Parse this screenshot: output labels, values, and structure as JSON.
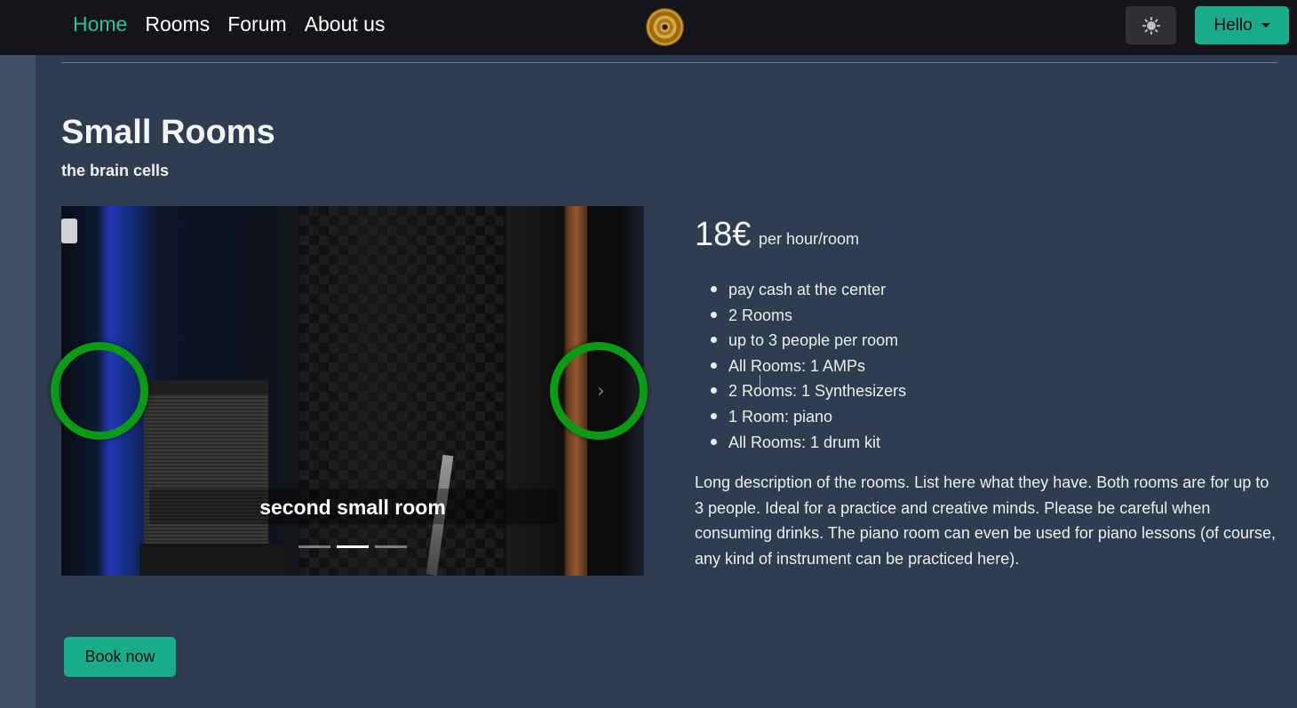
{
  "nav": {
    "links": [
      {
        "label": "Home",
        "active": true
      },
      {
        "label": "Rooms",
        "active": false
      },
      {
        "label": "Forum",
        "active": false
      },
      {
        "label": "About us",
        "active": false
      }
    ],
    "logo_icon": "vinyl-record-icon",
    "theme_icon": "sun-icon",
    "user_button_label": "Hello"
  },
  "room": {
    "title": "Small Rooms",
    "subtitle": "the brain cells",
    "carousel": {
      "caption": "second small room",
      "slide_count": 3,
      "active_index": 1
    },
    "price": "18€",
    "price_unit": "per hour/room",
    "features": [
      "pay cash at the center",
      "2 Rooms",
      "up to 3 people per room",
      "All Rooms: 1 AMPs",
      "2 Rooms: 1 Synthesizers",
      "1 Room: piano",
      "All Rooms: 1 drum kit"
    ],
    "description": "Long description of the rooms. List here what they have. Both rooms are for up to 3 people. Ideal for a practice and creative minds. Please be careful when consuming drinks. The piano room can even be used for piano lessons (of course, any kind of instrument can be practiced here).",
    "book_button_label": "Book now"
  },
  "colors": {
    "accent": "#1aab8a",
    "active_link": "#2fbf9b",
    "navbar_bg": "#131518",
    "page_bg": "#2e3d50",
    "carousel_control_ring": "#0a9a14"
  }
}
